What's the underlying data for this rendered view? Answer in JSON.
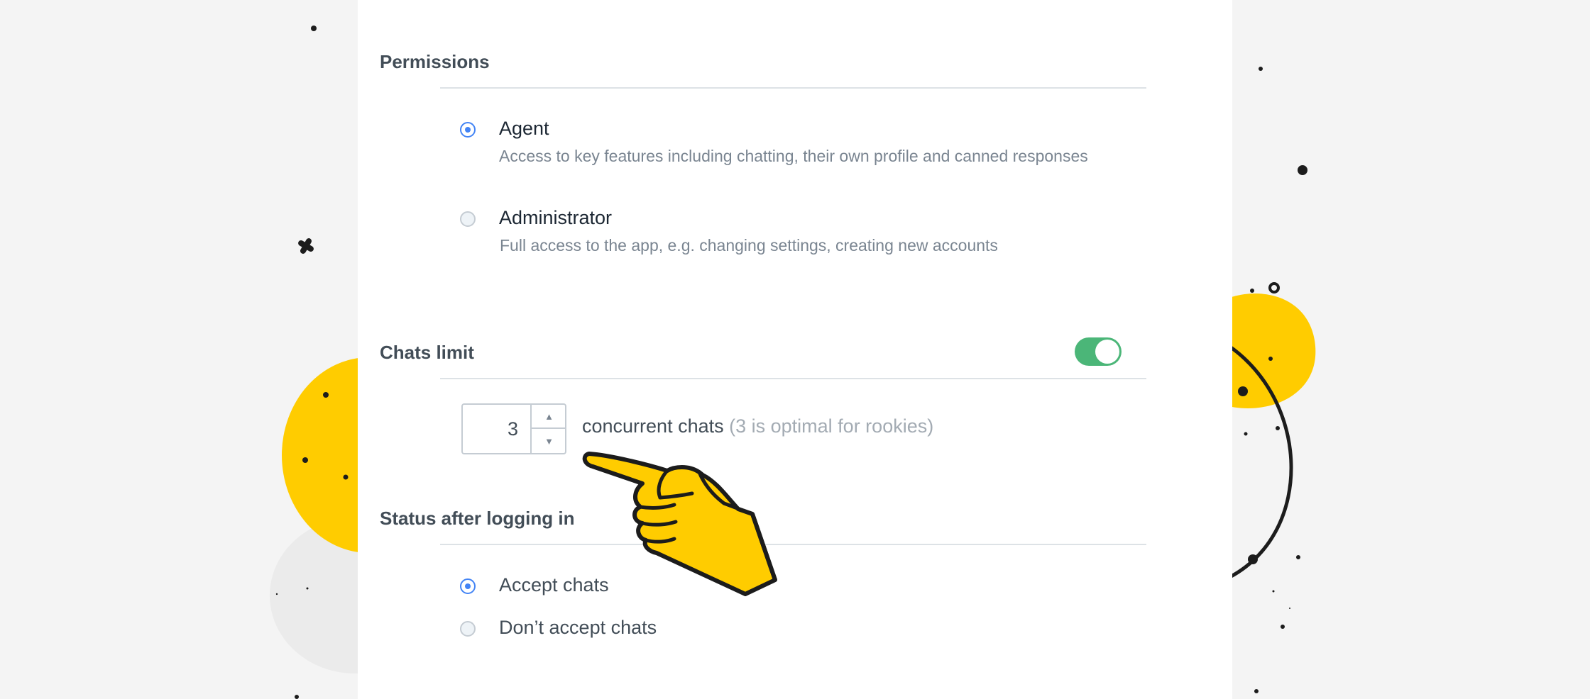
{
  "permissions": {
    "title": "Permissions",
    "options": [
      {
        "label": "Agent",
        "description": "Access to key features including chatting, their own profile and canned responses",
        "selected": true
      },
      {
        "label": "Administrator",
        "description": "Full access to the app, e.g. changing settings, creating new accounts",
        "selected": false
      }
    ]
  },
  "chats_limit": {
    "title": "Chats limit",
    "enabled": true,
    "value": "3",
    "label": "concurrent chats",
    "hint": "(3 is optimal for rookies)"
  },
  "status_after_login": {
    "title": "Status after logging in",
    "options": [
      {
        "label": "Accept chats",
        "selected": true
      },
      {
        "label": "Don’t accept chats",
        "selected": false
      }
    ]
  },
  "colors": {
    "accent_blue": "#4384f5",
    "toggle_green": "#4bb678",
    "illustration_yellow": "#ffcc00",
    "text_dark": "#424d57",
    "text_muted": "#7a8591"
  },
  "icons": [
    "radio-checked-icon",
    "radio-unchecked-icon",
    "chevron-up-icon",
    "chevron-down-icon",
    "pointing-hand-icon"
  ]
}
